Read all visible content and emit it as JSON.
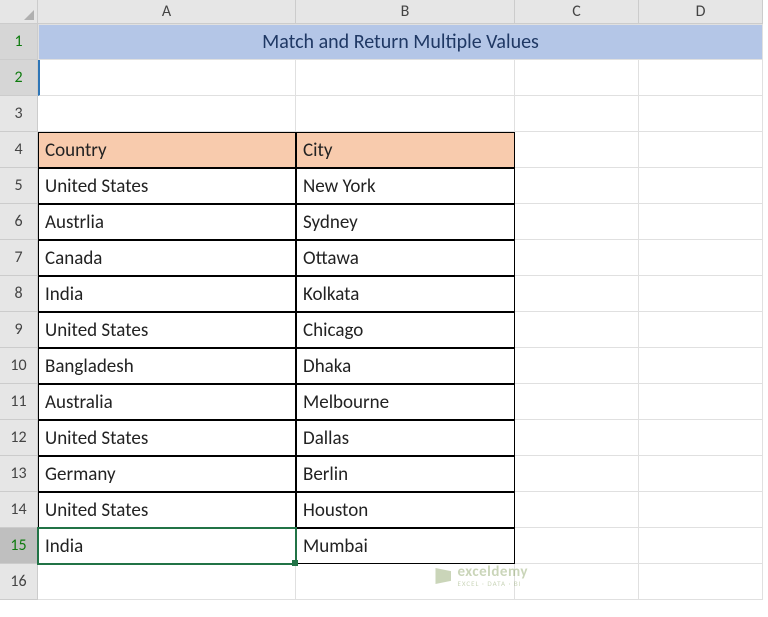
{
  "columns": [
    "A",
    "B",
    "C",
    "D"
  ],
  "row_count": 16,
  "selected_rows": [
    1,
    2
  ],
  "active_row": 15,
  "title": "Match and Return Multiple Values",
  "table": {
    "headers": {
      "country": "Country",
      "city": "City"
    },
    "rows": [
      {
        "country": "United States",
        "city": "New York"
      },
      {
        "country": "Austrlia",
        "city": "Sydney"
      },
      {
        "country": "Canada",
        "city": "Ottawa"
      },
      {
        "country": "India",
        "city": "Kolkata"
      },
      {
        "country": "United States",
        "city": "Chicago"
      },
      {
        "country": "Bangladesh",
        "city": "Dhaka"
      },
      {
        "country": "Australia",
        "city": "Melbourne"
      },
      {
        "country": "United States",
        "city": "Dallas"
      },
      {
        "country": "Germany",
        "city": "Berlin"
      },
      {
        "country": "United States",
        "city": "Houston"
      },
      {
        "country": "India",
        "city": "Mumbai"
      }
    ]
  },
  "watermark": {
    "brand": "exceldemy",
    "tagline": "EXCEL · DATA · BI"
  },
  "chart_data": {
    "type": "table",
    "title": "Match and Return Multiple Values",
    "columns": [
      "Country",
      "City"
    ],
    "rows": [
      [
        "United States",
        "New York"
      ],
      [
        "Austrlia",
        "Sydney"
      ],
      [
        "Canada",
        "Ottawa"
      ],
      [
        "India",
        "Kolkata"
      ],
      [
        "United States",
        "Chicago"
      ],
      [
        "Bangladesh",
        "Dhaka"
      ],
      [
        "Australia",
        "Melbourne"
      ],
      [
        "United States",
        "Dallas"
      ],
      [
        "Germany",
        "Berlin"
      ],
      [
        "United States",
        "Houston"
      ],
      [
        "India",
        "Mumbai"
      ]
    ]
  }
}
